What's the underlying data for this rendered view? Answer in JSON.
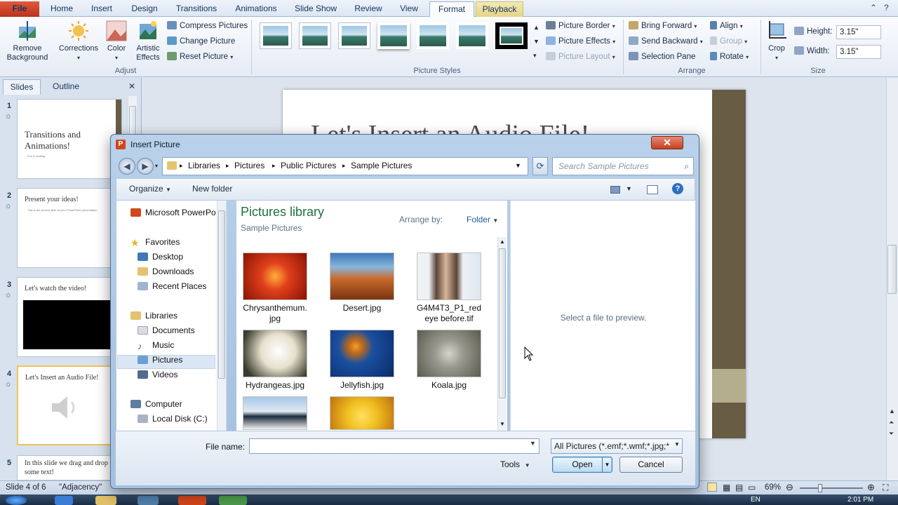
{
  "ribbon": {
    "tabs": [
      "File",
      "Home",
      "Insert",
      "Design",
      "Transitions",
      "Animations",
      "Slide Show",
      "Review",
      "View",
      "Format",
      "Playback"
    ],
    "active_tab": "Format",
    "adjust": {
      "remove_background": "Remove\nBackground",
      "corrections": "Corrections",
      "color": "Color",
      "artistic_effects": "Artistic\nEffects",
      "compress": "Compress Pictures",
      "change": "Change Picture",
      "reset": "Reset Picture",
      "label": "Adjust"
    },
    "styles": {
      "label": "Picture Styles",
      "border": "Picture Border",
      "effects": "Picture Effects",
      "layout": "Picture Layout"
    },
    "arrange": {
      "label": "Arrange",
      "bring_forward": "Bring Forward",
      "send_backward": "Send Backward",
      "selection_pane": "Selection Pane",
      "align": "Align",
      "group": "Group",
      "rotate": "Rotate"
    },
    "size": {
      "label": "Size",
      "crop": "Crop",
      "height_label": "Height:",
      "height_value": "3.15\"",
      "width_label": "Width:",
      "width_value": "3.15\""
    }
  },
  "slide_pane": {
    "tabs": [
      "Slides",
      "Outline"
    ],
    "thumbs": [
      {
        "num": "1",
        "title": "Transitions and\nAnimations!",
        "body": "Fun & exciting"
      },
      {
        "num": "2",
        "title": "Present your ideas!",
        "body": "This is the second slide of your PowerPoint presentation"
      },
      {
        "num": "3",
        "title": "Let's watch the video!",
        "body": ""
      },
      {
        "num": "4",
        "title": "Let's Insert an Audio File!",
        "body": ""
      },
      {
        "num": "5",
        "title": "In this slide we drag and drop\nsome text!",
        "body": ""
      }
    ]
  },
  "slide": {
    "title": "Let's Insert an Audio File!"
  },
  "status": {
    "slide_info": "Slide 4 of 6",
    "theme": "\"Adjacency\"",
    "zoom": "69%"
  },
  "taskbar": {
    "clock": "2:01 PM",
    "lang": "EN"
  },
  "dialog": {
    "title": "Insert Picture",
    "breadcrumb": [
      "Libraries",
      "Pictures",
      "Public Pictures",
      "Sample Pictures"
    ],
    "search_placeholder": "Search Sample Pictures",
    "organize": "Organize",
    "new_folder": "New folder",
    "nav": {
      "app": "Microsoft PowerPo",
      "favorites": "Favorites",
      "favorites_items": [
        "Desktop",
        "Downloads",
        "Recent Places"
      ],
      "libraries": "Libraries",
      "libraries_items": [
        "Documents",
        "Music",
        "Pictures",
        "Videos"
      ],
      "computer": "Computer",
      "computer_items": [
        "Local Disk (C:)"
      ]
    },
    "library_title": "Pictures library",
    "library_sub": "Sample Pictures",
    "arrange_label": "Arrange by:",
    "arrange_value": "Folder",
    "files": [
      {
        "name": "Chrysanthemum.\njpg",
        "color1": "#e0401c",
        "color2": "#8a1205"
      },
      {
        "name": "Desert.jpg",
        "color1": "#3c78b8",
        "color2": "#b8521e"
      },
      {
        "name": "G4M4T3_P1_red\neye before.tif",
        "color1": "#eef2f6",
        "color2": "#4a3a2e"
      },
      {
        "name": "Hydrangeas.jpg",
        "color1": "#f3eee2",
        "color2": "#3a3a2e"
      },
      {
        "name": "Jellyfish.jpg",
        "color1": "#1a4fa0",
        "color2": "#e08a20"
      },
      {
        "name": "Koala.jpg",
        "color1": "#9a9a90",
        "color2": "#4a4a40"
      },
      {
        "name": "",
        "color1": "#a8c6e6",
        "color2": "#1c2b3c"
      },
      {
        "name": "",
        "color1": "#f0c020",
        "color2": "#c07010"
      }
    ],
    "preview_msg": "Select a file to preview.",
    "file_name_label": "File name:",
    "file_name_value": "",
    "file_type": "All Pictures (*.emf;*.wmf;*.jpg;*",
    "tools": "Tools",
    "open": "Open",
    "cancel": "Cancel"
  }
}
